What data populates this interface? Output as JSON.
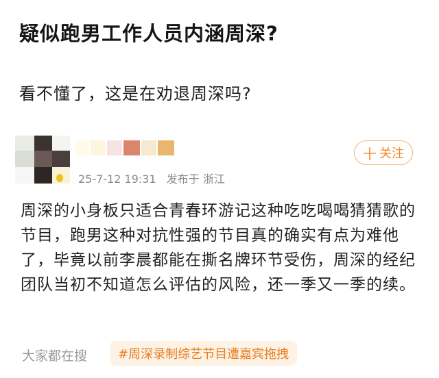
{
  "post": {
    "title": "疑似跑男工作人员内涵周深?",
    "subtitle": "看不懂了，这是在劝退周深吗?"
  },
  "comment": {
    "date": "25-7-12 19:31",
    "location": "发布于 浙江",
    "follow_label": "关注",
    "body": "周深的小身板只适合青春环游记这种吃吃喝喝猜猜歌的节目，跑男这种对抗性强的节目真的确实有点为难他了，毕竟以前李晨都能在撕名牌环节受伤，周深的经纪团队当初不知道怎么评估的风险，还一季又一季的续。"
  },
  "search": {
    "label": "大家都在搜",
    "topic": "#周深录制综艺节目遭嘉宾拖拽"
  },
  "colors": {
    "accent": "#f08a24",
    "topic_bg": "#fdf2e3"
  }
}
